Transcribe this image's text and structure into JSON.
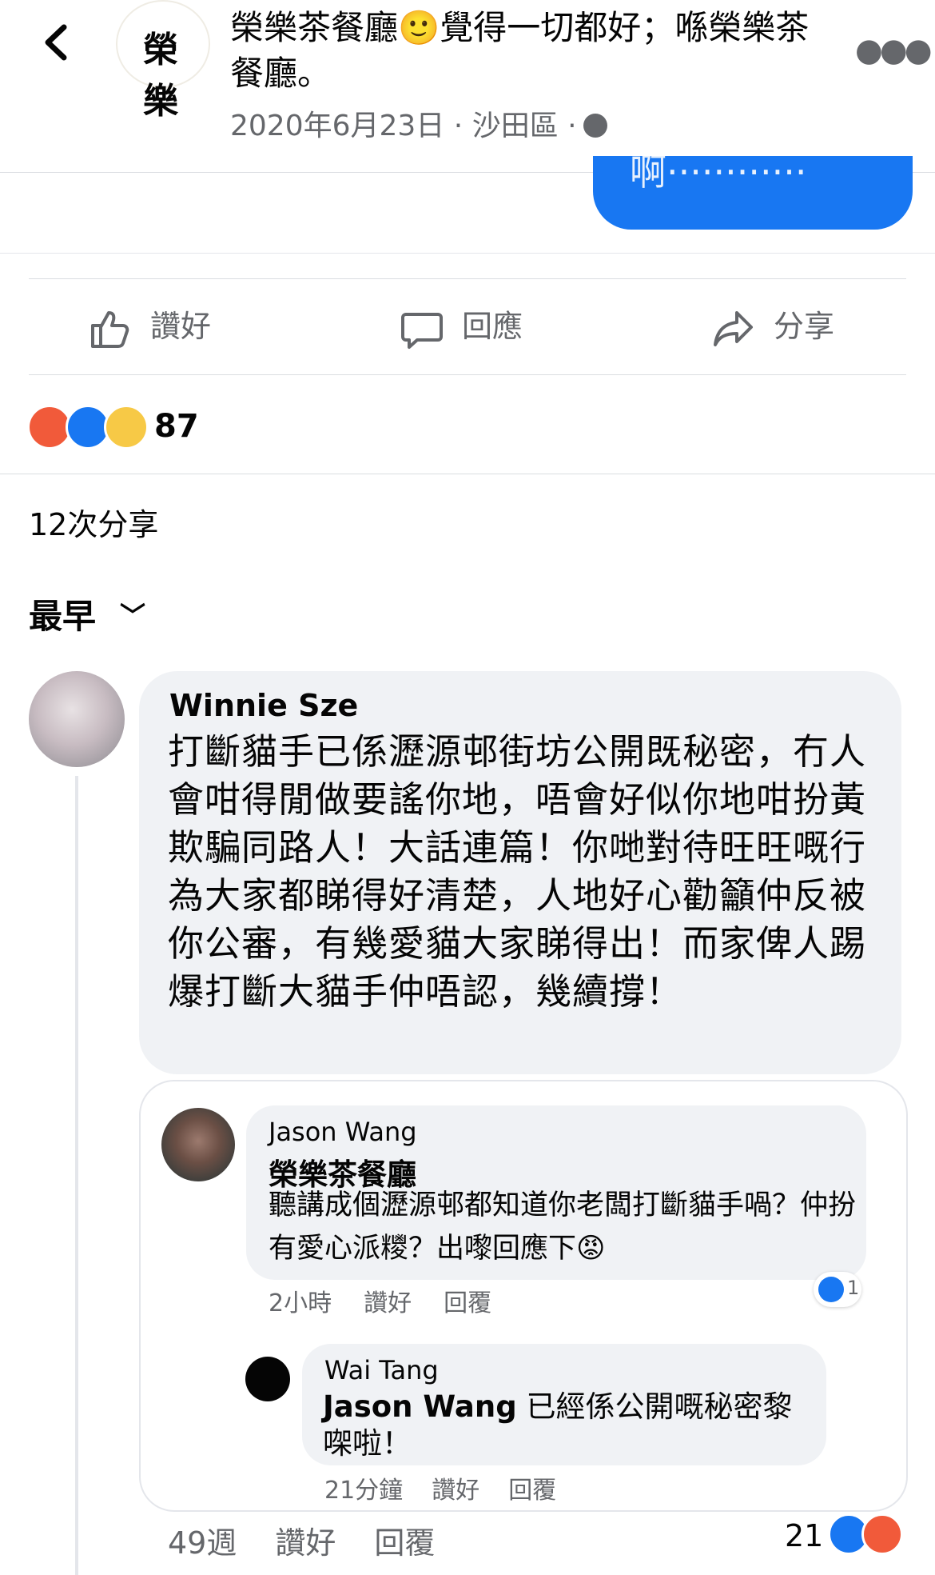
{
  "header": {
    "page_logo_text": "榮 樂",
    "title": "榮樂茶餐廳🙂覺得一切都好；喺榮樂茶餐廳。",
    "date": "2020年6月23日",
    "location": "沙田區",
    "separator": "·"
  },
  "image_fragment_text": "啊············",
  "actions": {
    "like": "讚好",
    "comment": "回應",
    "share": "分享"
  },
  "reactions": {
    "count": "87",
    "icons": [
      "angry-icon",
      "like-icon",
      "sad-icon"
    ]
  },
  "shares_text": "12次分享",
  "sort_label": "最早",
  "comments": [
    {
      "author": "Winnie Sze",
      "text": "打斷貓手已係瀝源邨街坊公開既秘密，冇人會咁得閒做要謠你地，唔會好似你地咁扮黃欺騙同路人！大話連篇！你哋對待旺旺嘅行為大家都睇得好清楚，人地好心勸籲仲反被你公審，有幾愛貓大家睇得出！而家俾人踢爆打斷大貓手仲唔認，幾續撐！",
      "time": "49週",
      "like_label": "讚好",
      "reply_label": "回覆",
      "reaction_count": "21",
      "replies": [
        {
          "author": "Jason Wang",
          "tag": "榮樂茶餐廳",
          "text": "聽講成個瀝源邨都知道你老闆打斷貓手喎？仲扮有愛心派糭？出嚟回應下😡",
          "time": "2小時",
          "like_label": "讚好",
          "reply_label": "回覆",
          "like_count": "1"
        },
        {
          "author": "Wai Tang",
          "mention": "Jason Wang",
          "text": "已經係公開嘅秘密黎㗎啦！",
          "time": "21分鐘",
          "like_label": "讚好",
          "reply_label": "回覆"
        }
      ]
    }
  ],
  "colors": {
    "brand_blue": "#1877f2",
    "muted_text": "#65676b",
    "bubble_bg": "#f0f2f5",
    "angry": "#f15a3a",
    "sad": "#f7c946"
  }
}
